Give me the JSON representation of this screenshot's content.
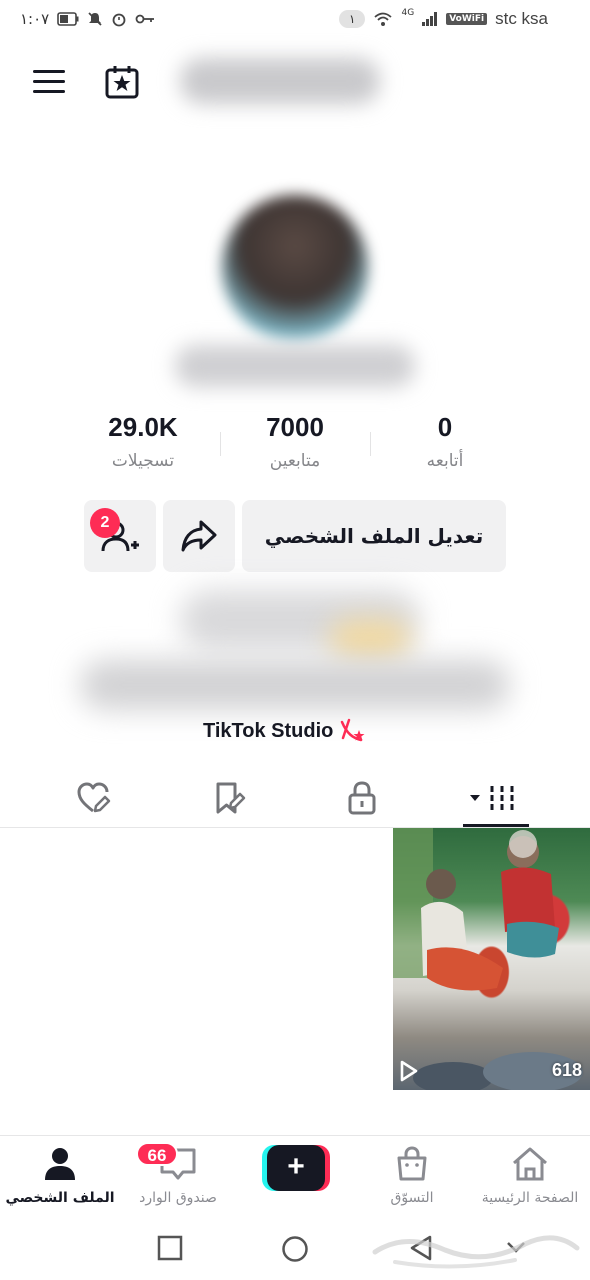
{
  "status_bar": {
    "time": "١:٠٧",
    "notification_count": "١",
    "network": "4G",
    "wifi_badge": "VoWiFi",
    "carrier": "stc ksa"
  },
  "profile": {
    "stats": [
      {
        "value": "0",
        "label": "أتابعه"
      },
      {
        "value": "7000",
        "label": "متابعين"
      },
      {
        "value": "29.0K",
        "label": "تسجيلات"
      }
    ],
    "edit_button": "تعديل الملف الشخصي",
    "friend_requests_badge": "2",
    "studio_link": "TikTok Studio"
  },
  "tabs": [
    {
      "icon": "grid-icon",
      "active": true
    },
    {
      "icon": "lock-icon",
      "active": false
    },
    {
      "icon": "bookmark-icon",
      "active": false
    },
    {
      "icon": "liked-icon",
      "active": false
    }
  ],
  "videos": [
    {
      "views": "618"
    }
  ],
  "bottom_nav": {
    "home": "الصفحة الرئيسية",
    "shop": "التسوّق",
    "create": "+",
    "inbox": "صندوق الوارد",
    "inbox_badge": "66",
    "profile": "الملف الشخصي"
  },
  "colors": {
    "accent": "#fe2c55",
    "cyan": "#25f4ee",
    "text": "#161823",
    "muted": "#86878b",
    "button_bg": "#f1f1f2"
  }
}
